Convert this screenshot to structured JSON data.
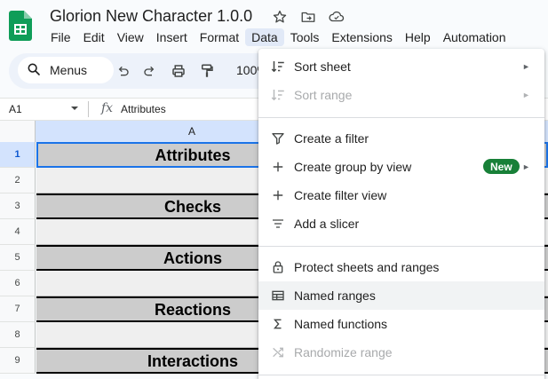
{
  "document": {
    "title": "Glorion New Character 1.0.0"
  },
  "menubar": {
    "items": [
      "File",
      "Edit",
      "View",
      "Insert",
      "Format",
      "Data",
      "Tools",
      "Extensions",
      "Help",
      "Automation"
    ],
    "active": "Data"
  },
  "toolbar": {
    "search_label": "Menus",
    "zoom": "100%"
  },
  "formula_bar": {
    "cell_ref": "A1",
    "content": "Attributes"
  },
  "grid": {
    "column_header": "A",
    "rows": [
      {
        "num": "1",
        "text": "Attributes",
        "type": "header",
        "selected": true
      },
      {
        "num": "2",
        "text": "",
        "type": "body"
      },
      {
        "num": "3",
        "text": "Checks",
        "type": "header"
      },
      {
        "num": "4",
        "text": "",
        "type": "body"
      },
      {
        "num": "5",
        "text": "Actions",
        "type": "header"
      },
      {
        "num": "6",
        "text": "",
        "type": "body"
      },
      {
        "num": "7",
        "text": "Reactions",
        "type": "header"
      },
      {
        "num": "8",
        "text": "",
        "type": "body"
      },
      {
        "num": "9",
        "text": "Interactions",
        "type": "header"
      }
    ]
  },
  "data_menu": {
    "items": [
      {
        "label": "Sort sheet",
        "icon": "sort-icon",
        "submenu": true,
        "disabled": false
      },
      {
        "label": "Sort range",
        "icon": "sort-icon",
        "submenu": true,
        "disabled": true
      },
      {
        "label": "Create a filter",
        "icon": "filter-icon",
        "submenu": false,
        "disabled": false
      },
      {
        "label": "Create group by view",
        "icon": "plus-icon",
        "submenu": true,
        "disabled": false,
        "badge": "New"
      },
      {
        "label": "Create filter view",
        "icon": "plus-icon",
        "submenu": false,
        "disabled": false
      },
      {
        "label": "Add a slicer",
        "icon": "slicer-icon",
        "submenu": false,
        "disabled": false
      },
      {
        "label": "Protect sheets and ranges",
        "icon": "lock-icon",
        "submenu": false,
        "disabled": false
      },
      {
        "label": "Named ranges",
        "icon": "named-ranges-icon",
        "submenu": false,
        "disabled": false,
        "hover": true
      },
      {
        "label": "Named functions",
        "icon": "sigma-icon",
        "submenu": false,
        "disabled": false
      },
      {
        "label": "Randomize range",
        "icon": "shuffle-icon",
        "submenu": false,
        "disabled": true
      }
    ]
  },
  "colors": {
    "accent": "#1a73e8",
    "badge": "#188038",
    "logo": "#0f9d58",
    "header_cell": "#cccccc"
  }
}
